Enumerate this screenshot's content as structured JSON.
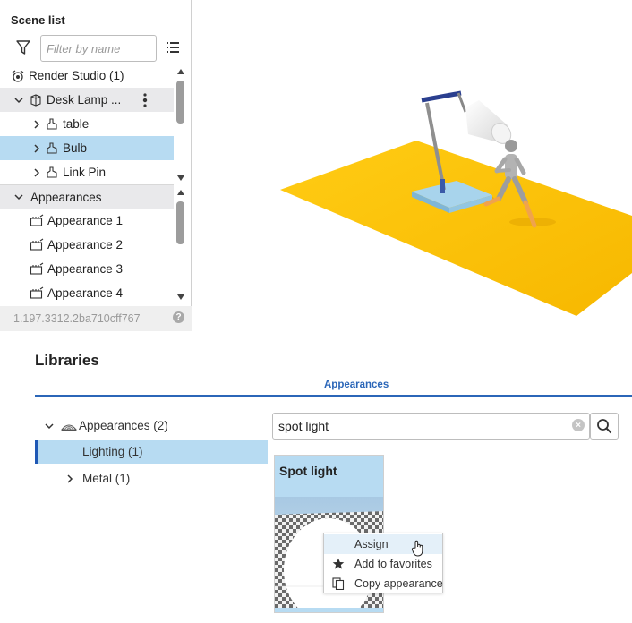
{
  "scene_list": {
    "title": "Scene list",
    "filter": {
      "placeholder": "Filter by name",
      "value": ""
    },
    "root": {
      "label": "Render Studio (1)",
      "icon": "render-studio-icon"
    },
    "items": [
      {
        "label": "Desk Lamp ...",
        "icon": "assembly-icon",
        "expanded": true
      },
      {
        "label": "table",
        "icon": "part-icon",
        "expanded": false
      },
      {
        "label": "Bulb",
        "icon": "part-icon",
        "expanded": false,
        "selected": true
      },
      {
        "label": "Link Pin",
        "icon": "part-icon",
        "expanded": false
      }
    ],
    "appearances_group": {
      "label": "Appearances",
      "expanded": true
    },
    "appearances": [
      {
        "label": "Appearance 1",
        "icon": "appearance-icon"
      },
      {
        "label": "Appearance 2",
        "icon": "appearance-icon"
      },
      {
        "label": "Appearance 3",
        "icon": "appearance-icon"
      },
      {
        "label": "Appearance 4",
        "icon": "appearance-icon"
      }
    ],
    "version": "1.197.3312.2ba710cff767",
    "help": "?"
  },
  "libraries": {
    "title": "Libraries",
    "active_tab": "Appearances",
    "tree": {
      "root": {
        "label": "Appearances (2)",
        "expanded": true,
        "icon": "material-icon"
      },
      "children": [
        {
          "label": "Lighting (1)",
          "selected": true
        },
        {
          "label": "Metal (1)",
          "expanded": false
        }
      ]
    },
    "search": {
      "value": "spot light"
    },
    "card": {
      "title": "Spot light"
    },
    "context_menu": [
      {
        "label": "Assign",
        "icon": ""
      },
      {
        "label": "Add to favorites",
        "icon": "star-icon"
      },
      {
        "label": "Copy appearance",
        "icon": "copy-icon"
      }
    ]
  },
  "colors": {
    "accent": "#2b66b8",
    "selection": "#b7dbf2",
    "floor": "#fbc100",
    "lamp_base": "#a8d4ec"
  }
}
